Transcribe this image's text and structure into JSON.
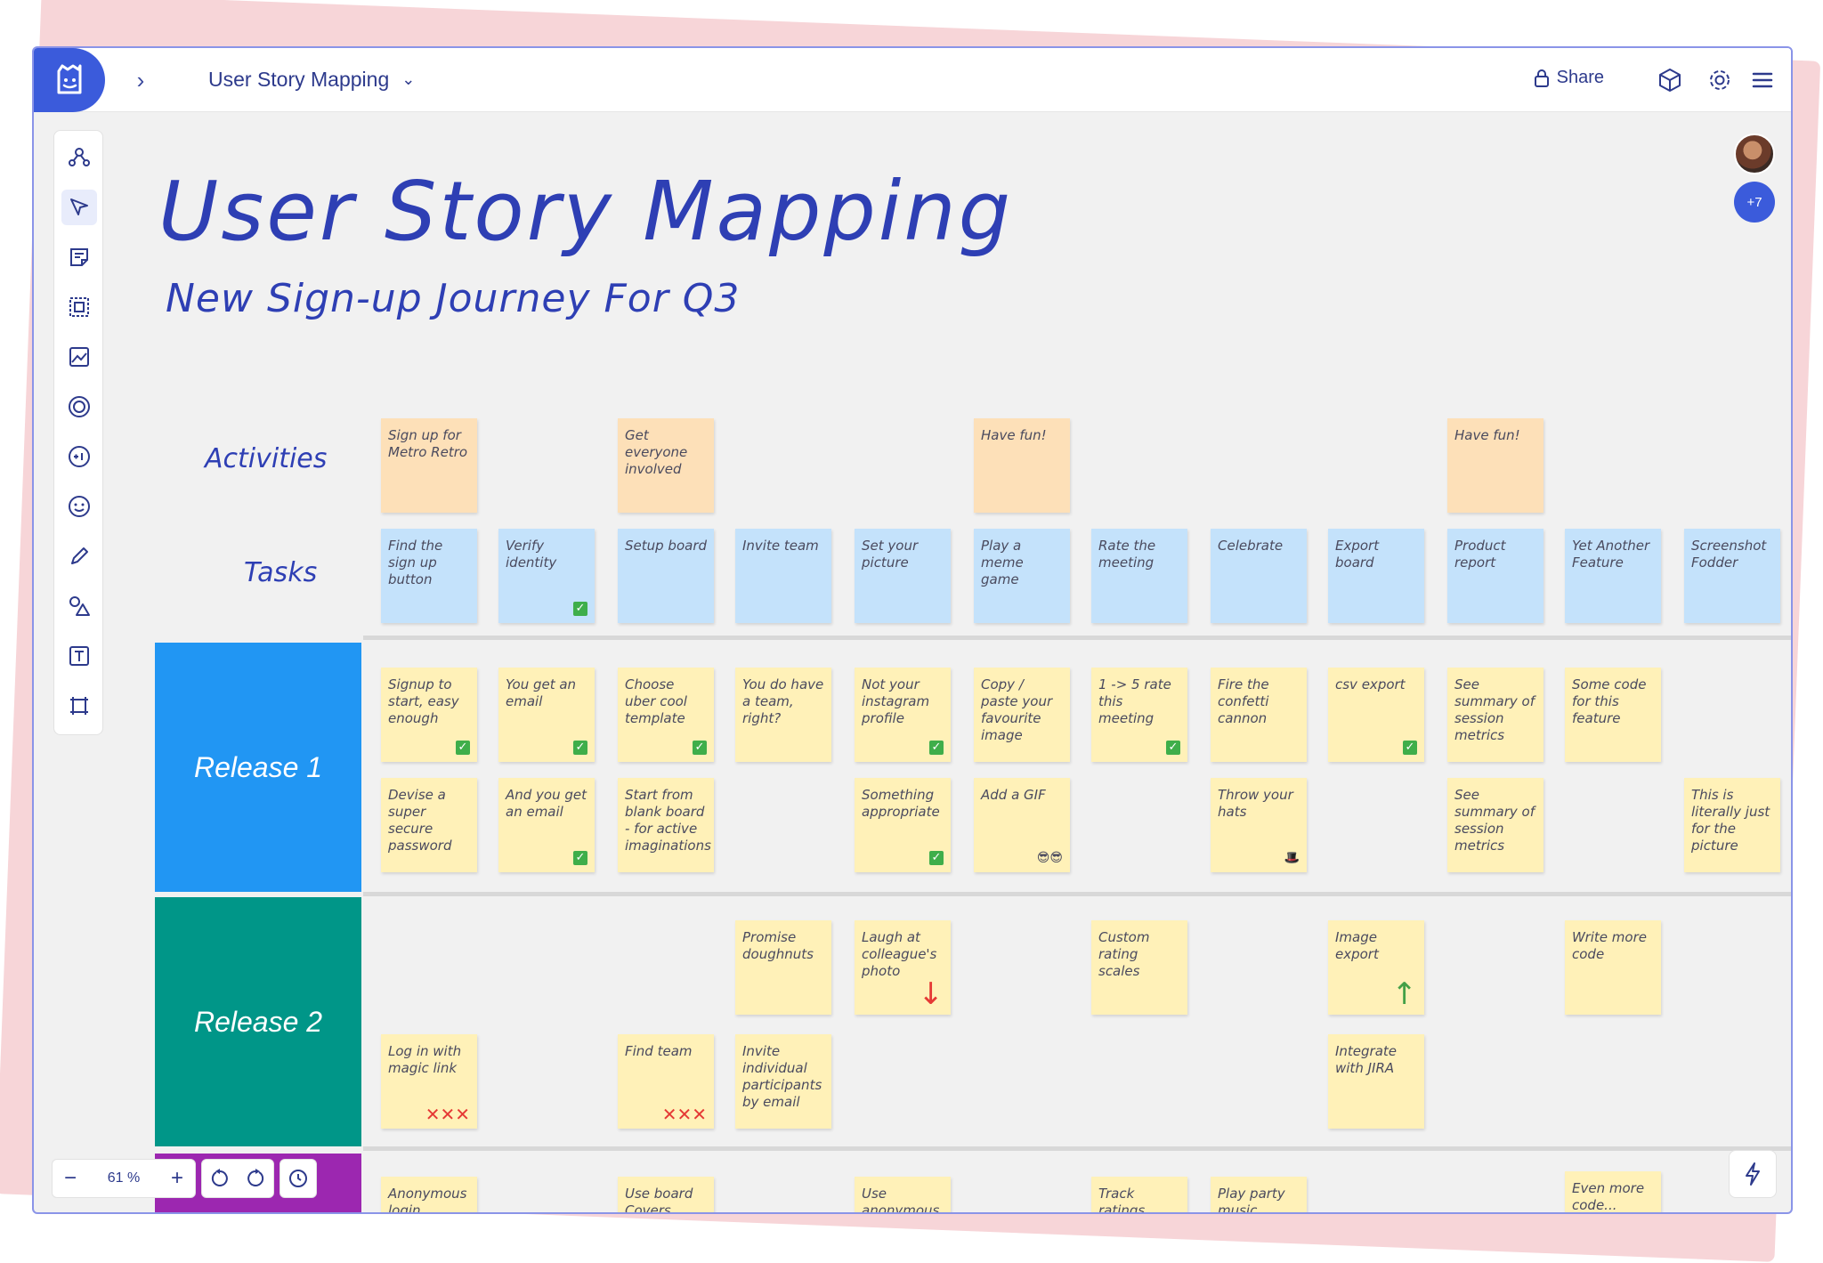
{
  "app": {
    "board_title": "User Story Mapping",
    "share_label": "Share",
    "online_users_count": "+7",
    "zoom_level": "61 %"
  },
  "toolbar": {
    "tools": [
      "team-icon",
      "select-icon",
      "sticky-note-icon",
      "frame-icon",
      "image-icon",
      "vote-icon",
      "plus-one-icon",
      "emoji-icon",
      "pen-icon",
      "shapes-icon",
      "text-icon",
      "crop-icon"
    ]
  },
  "canvas": {
    "title": "User Story Mapping",
    "subtitle": "New Sign-up Journey For Q3",
    "activities_label": "Activities",
    "tasks_label": "Tasks",
    "releases": [
      {
        "label": "Release 1",
        "color": "#2196f3"
      },
      {
        "label": "Release 2",
        "color": "#009688"
      },
      {
        "label": "",
        "color": "#9c27b0"
      }
    ],
    "activities": [
      "Sign up for Metro Retro",
      "Get everyone involved",
      "Have fun!",
      "Have fun!"
    ],
    "tasks": [
      "Find the sign up button",
      "Verify identity",
      "Setup board",
      "Invite team",
      "Set your picture",
      "Play a meme game",
      "Rate the meeting",
      "Celebrate",
      "Export board",
      "Product report",
      "Yet Another Feature",
      "Screenshot Fodder"
    ],
    "release1": [
      "Signup to start, easy enough",
      "You get an email",
      "Choose uber cool template",
      "You do have a team, right?",
      "Not your instagram profile",
      "Copy / paste your favourite image",
      "1 -> 5 rate this meeting",
      "Fire the confetti cannon",
      "csv export",
      "See summary of session metrics",
      "Some code for this feature",
      "Devise a super secure password",
      "And you get an email",
      "Start from blank board - for active imaginations",
      "Something appropriate",
      "Add a GIF",
      "Throw your hats",
      "See summary of session metrics",
      "This is literally just for the picture"
    ],
    "release2": [
      "Promise doughnuts",
      "Laugh at colleague's photo",
      "Custom rating scales",
      "Image export",
      "Write more code",
      "Log in with magic link",
      "Find team",
      "Invite individual participants by email",
      "Integrate with JIRA"
    ],
    "release3": [
      "Anonymous login",
      "Use board Covers",
      "Use anonymous",
      "Track ratings",
      "Play party music",
      "Even more code..."
    ]
  }
}
